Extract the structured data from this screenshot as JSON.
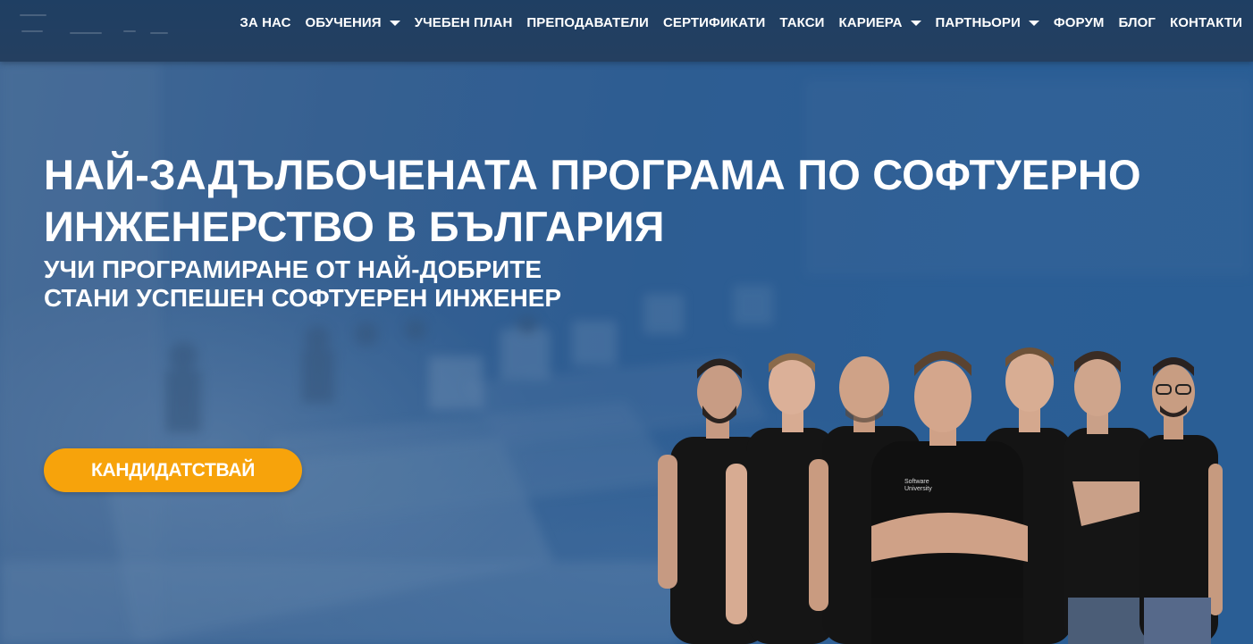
{
  "nav": {
    "items": [
      {
        "label": "ЗА НАС",
        "has_dropdown": false
      },
      {
        "label": "ОБУЧЕНИЯ",
        "has_dropdown": true
      },
      {
        "label": "УЧЕБЕН ПЛАН",
        "has_dropdown": false
      },
      {
        "label": "ПРЕПОДАВАТЕЛИ",
        "has_dropdown": false
      },
      {
        "label": "СЕРТИФИКАТИ",
        "has_dropdown": false
      },
      {
        "label": "ТАКСИ",
        "has_dropdown": false
      },
      {
        "label": "КАРИЕРА",
        "has_dropdown": true
      },
      {
        "label": "ПАРТНЬОРИ",
        "has_dropdown": true
      },
      {
        "label": "ФОРУМ",
        "has_dropdown": false
      },
      {
        "label": "БЛОГ",
        "has_dropdown": false
      },
      {
        "label": "КОНТАКТИ",
        "has_dropdown": false
      }
    ]
  },
  "hero": {
    "title_line1": "НАЙ-ЗАДЪЛБОЧЕНАТА ПРОГРАМА ПО СОФТУЕРНО",
    "title_line2": "ИНЖЕНЕРСТВО В БЪЛГАРИЯ",
    "subtitle_line1": "УЧИ ПРОГРАМИРАНЕ ОТ НАЙ-ДОБРИТЕ",
    "subtitle_line2": "СТАНИ УСПЕШЕН СОФТУЕРЕН ИНЖЕНЕР",
    "cta_label": "КАНДИДАТСТВАЙ",
    "team_photo": "team-of-seven-instructors-in-black-tshirts"
  },
  "colors": {
    "nav_bg": "#243f60",
    "hero_overlay": "#2b5e96",
    "cta": "#f7a30b",
    "text": "#ffffff",
    "shirt": "#111111"
  }
}
